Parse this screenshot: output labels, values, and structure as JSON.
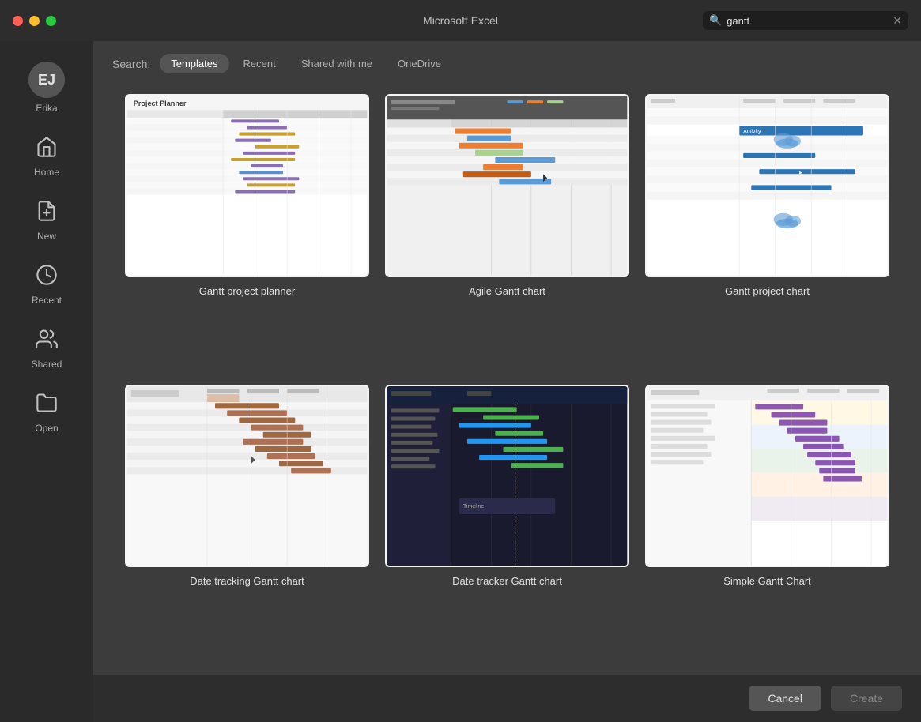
{
  "titleBar": {
    "title": "Microsoft Excel",
    "searchPlaceholder": "gantt",
    "searchValue": "gantt"
  },
  "sidebar": {
    "user": {
      "initials": "EJ",
      "name": "Erika"
    },
    "items": [
      {
        "id": "home",
        "label": "Home",
        "icon": "home"
      },
      {
        "id": "new",
        "label": "New",
        "icon": "new"
      },
      {
        "id": "recent",
        "label": "Recent",
        "icon": "recent"
      },
      {
        "id": "shared",
        "label": "Shared",
        "icon": "shared"
      },
      {
        "id": "open",
        "label": "Open",
        "icon": "open"
      }
    ]
  },
  "filterBar": {
    "label": "Search:",
    "tabs": [
      {
        "id": "templates",
        "label": "Templates",
        "active": true
      },
      {
        "id": "recent",
        "label": "Recent",
        "active": false
      },
      {
        "id": "shared",
        "label": "Shared with me",
        "active": false
      },
      {
        "id": "onedrive",
        "label": "OneDrive",
        "active": false
      }
    ]
  },
  "templates": [
    {
      "id": "gantt-planner",
      "name": "Gantt project planner"
    },
    {
      "id": "agile-gantt",
      "name": "Agile Gantt chart"
    },
    {
      "id": "gantt-project-chart",
      "name": "Gantt project chart"
    },
    {
      "id": "date-tracking",
      "name": "Date tracking Gantt chart"
    },
    {
      "id": "date-tracker",
      "name": "Date tracker Gantt chart"
    },
    {
      "id": "simple-gantt",
      "name": "Simple Gantt Chart"
    }
  ],
  "bottomBar": {
    "cancelLabel": "Cancel",
    "createLabel": "Create"
  }
}
